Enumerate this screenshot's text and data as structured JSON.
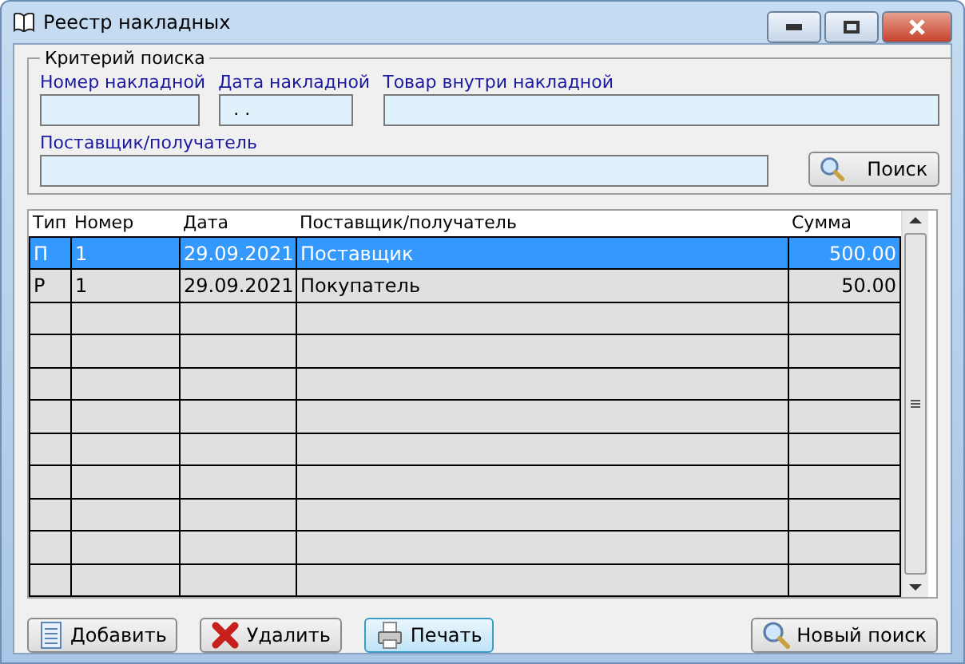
{
  "window": {
    "title": "Реестр накладных"
  },
  "search_criteria": {
    "title": "Критерий поиска",
    "fields": [
      {
        "label": "Номер накладной"
      },
      {
        "label": "Дата накладной",
        "value": " . ."
      },
      {
        "label": "Товар внутри накладной"
      },
      {
        "label": "Поставщик/получатель"
      }
    ],
    "search_button": "Поиск"
  },
  "table": {
    "columns": [
      "Тип",
      "Номер",
      "Дата",
      "Поставщик/получатель",
      "Сумма"
    ],
    "rows": [
      {
        "cells": [
          "П",
          "1",
          "29.09.2021",
          "Поставщик",
          "500.00"
        ],
        "selected": true
      },
      {
        "cells": [
          "Р",
          "1",
          "29.09.2021",
          "Покупатель",
          "50.00"
        ],
        "selected": false
      }
    ]
  },
  "buttons": [
    {
      "kind": "add",
      "label": "Добавить",
      "focused": false
    },
    {
      "kind": "delete",
      "label": "Удалить",
      "focused": false
    },
    {
      "kind": "print",
      "label": "Печать",
      "focused": true
    },
    {
      "kind": "search",
      "label": "Новый поиск",
      "focused": false
    }
  ]
}
